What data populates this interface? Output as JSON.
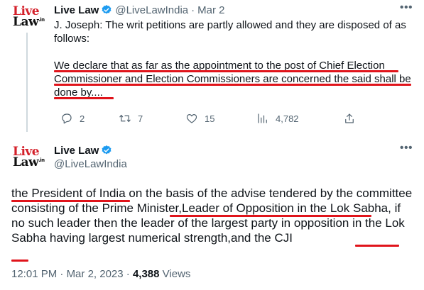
{
  "tweet1": {
    "avatar": {
      "line1": "Live",
      "line2": "Law",
      "sup": ".in"
    },
    "name": "Live Law",
    "handle": "@LiveLawIndia",
    "separator": "·",
    "date": "Mar 2",
    "paragraph1": "J. Joseph: The writ petitions are partly allowed and they are disposed of as follows:",
    "paragraph2": "We declare that as far as the appointment to the post of Chief Election Commissioner and Election Commissioners are concerned the said shall be done by....",
    "actions": {
      "replies": "2",
      "retweets": "7",
      "likes": "15",
      "views": "4,782"
    }
  },
  "tweet2": {
    "avatar": {
      "line1": "Live",
      "line2": "Law",
      "sup": ".in"
    },
    "name": "Live Law",
    "handle": "@LiveLawIndia",
    "body": "the President of India on the basis of the advise tendered by the committee consisting of the Prime Minister,Leader of Opposition in the Lok Sabha, if no such leader then the leader of the largest party in opposition in the Lok Sabha having largest numerical strength,and the CJI",
    "time": "12:01 PM",
    "date": "Mar 2, 2023",
    "views_count": "4,388",
    "views_label": "Views"
  },
  "colors": {
    "accent": "#1d9bf0",
    "brand_red": "#d4202a",
    "underline": "#e0141b",
    "muted": "#536471"
  }
}
